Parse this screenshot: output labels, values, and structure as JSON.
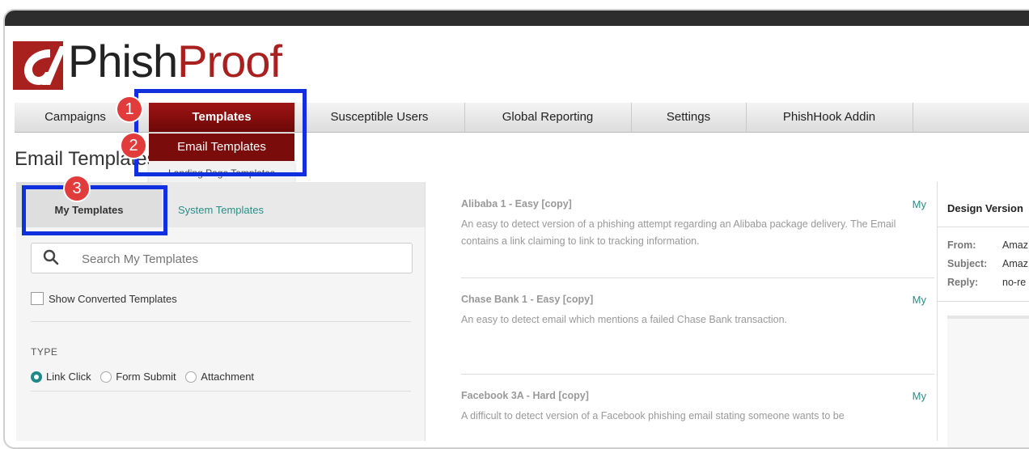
{
  "logo": {
    "text_main": "Phish",
    "text_accent": "Proof"
  },
  "nav": {
    "items": [
      {
        "label": "Campaigns"
      },
      {
        "label": "Templates"
      },
      {
        "label": "Susceptible Users"
      },
      {
        "label": "Global Reporting"
      },
      {
        "label": "Settings"
      },
      {
        "label": "PhishHook Addin"
      }
    ],
    "active_item": "Templates",
    "submenu": {
      "item1": "Email Templates",
      "item2": "Landing Page Templates"
    }
  },
  "page": {
    "title": "Email Templates"
  },
  "badges": {
    "b1": "1",
    "b2": "2",
    "b3": "3"
  },
  "left_panel": {
    "tabs": {
      "my": "My Templates",
      "system": "System Templates"
    },
    "search_placeholder": "Search My Templates",
    "show_converted": "Show Converted Templates",
    "type_label": "TYPE",
    "type_options": {
      "link_click": "Link Click",
      "form_submit": "Form Submit",
      "attachment": "Attachment"
    },
    "type_selected": "Link Click"
  },
  "templates": [
    {
      "title": "Alibaba 1 - Easy [copy]",
      "tag": "My",
      "description": "An easy to detect version of a phishing attempt regarding an Alibaba package delivery. The Email contains a link claiming to link to tracking information."
    },
    {
      "title": "Chase Bank 1 - Easy [copy]",
      "tag": "My",
      "description": "An easy to detect email which mentions a failed Chase Bank transaction."
    },
    {
      "title": "Facebook 3A - Hard [copy]",
      "tag": "My",
      "description": "A difficult to detect version of a Facebook phishing email stating someone wants to be"
    }
  ],
  "right_panel": {
    "title": "Design Version",
    "from_label": "From:",
    "from_value": "Amaz",
    "subject_label": "Subject:",
    "subject_value": "Amaz",
    "reply_label": "Reply:",
    "reply_value": "no-re"
  },
  "colors": {
    "brand_red": "#a8211f",
    "highlight_blue": "#1030e0",
    "badge_red": "#e23b3b",
    "teal": "#2a8d86"
  }
}
